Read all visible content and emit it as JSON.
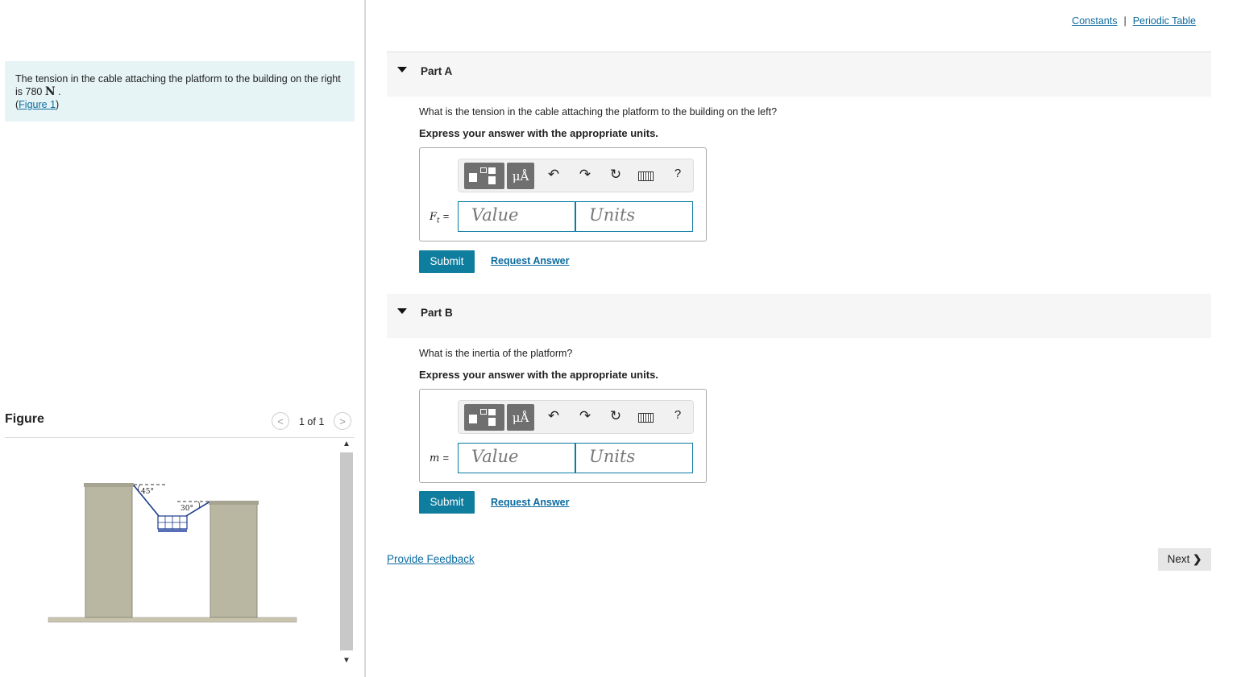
{
  "intro": {
    "text_before": "The tension in the cable attaching the platform to the building on the right is 780 ",
    "unit": "N",
    "text_after": " .",
    "figure_link": "Figure 1"
  },
  "figure_panel": {
    "title": "Figure",
    "counter": "1 of 1",
    "prev_icon": "<",
    "next_icon": ">",
    "angle_left": "45°",
    "angle_right": "30°",
    "scroll_up": "▲",
    "scroll_down": "▼"
  },
  "top_links": {
    "constants": "Constants",
    "separator": "|",
    "periodic_table": "Periodic Table"
  },
  "parts": [
    {
      "title": "Part A",
      "question": "What is the tension in the cable attaching the platform to the building on the left?",
      "instruction": "Express your answer with the appropriate units.",
      "variable": "Ft",
      "variable_sub": "t",
      "equals": "=",
      "value_placeholder": "Value",
      "units_placeholder": "Units",
      "submit": "Submit",
      "request": "Request Answer"
    },
    {
      "title": "Part B",
      "question": "What is the inertia of the platform?",
      "instruction": "Express your answer with the appropriate units.",
      "variable": "m",
      "equals": "=",
      "value_placeholder": "Value",
      "units_placeholder": "Units",
      "submit": "Submit",
      "request": "Request Answer"
    }
  ],
  "toolbar": {
    "mu_a": "μÅ",
    "undo_icon": "↶",
    "redo_icon": "↷",
    "reset_icon": "↻",
    "help": "?"
  },
  "footer": {
    "feedback": "Provide Feedback",
    "next": "Next",
    "next_chevron": "❯"
  }
}
